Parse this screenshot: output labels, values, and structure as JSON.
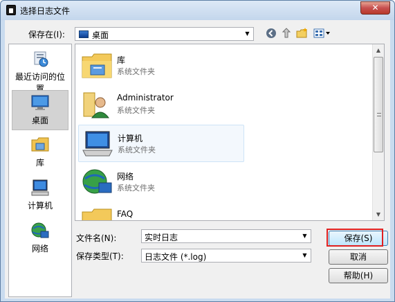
{
  "window": {
    "title": "选择日志文件",
    "close_label": "✕"
  },
  "toolbar": {
    "save_in_label": "保存在(I):",
    "location_value": "桌面",
    "icons": [
      "back-icon",
      "up-folder-icon",
      "new-folder-icon",
      "view-menu-icon"
    ]
  },
  "sidebar": {
    "items": [
      {
        "label": "最近访问的位置",
        "icon": "recent-places-icon"
      },
      {
        "label": "桌面",
        "icon": "desktop-icon",
        "selected": true
      },
      {
        "label": "库",
        "icon": "libraries-icon"
      },
      {
        "label": "计算机",
        "icon": "computer-icon"
      },
      {
        "label": "网络",
        "icon": "network-icon"
      }
    ]
  },
  "files": [
    {
      "name": "库",
      "type": "系统文件夹",
      "icon": "libraries-icon"
    },
    {
      "name": "Administrator",
      "type": "系统文件夹",
      "icon": "user-folder-icon"
    },
    {
      "name": "计算机",
      "type": "系统文件夹",
      "icon": "computer-icon"
    },
    {
      "name": "网络",
      "type": "系统文件夹",
      "icon": "network-icon"
    },
    {
      "name": "FAQ",
      "type": "",
      "icon": "folder-icon"
    }
  ],
  "form": {
    "filename_label": "文件名(N):",
    "filename_value": "实时日志",
    "filetype_label": "保存类型(T):",
    "filetype_value": "日志文件 (*.log)"
  },
  "buttons": {
    "save": "保存(S)",
    "cancel": "取消",
    "help": "帮助(H)"
  }
}
